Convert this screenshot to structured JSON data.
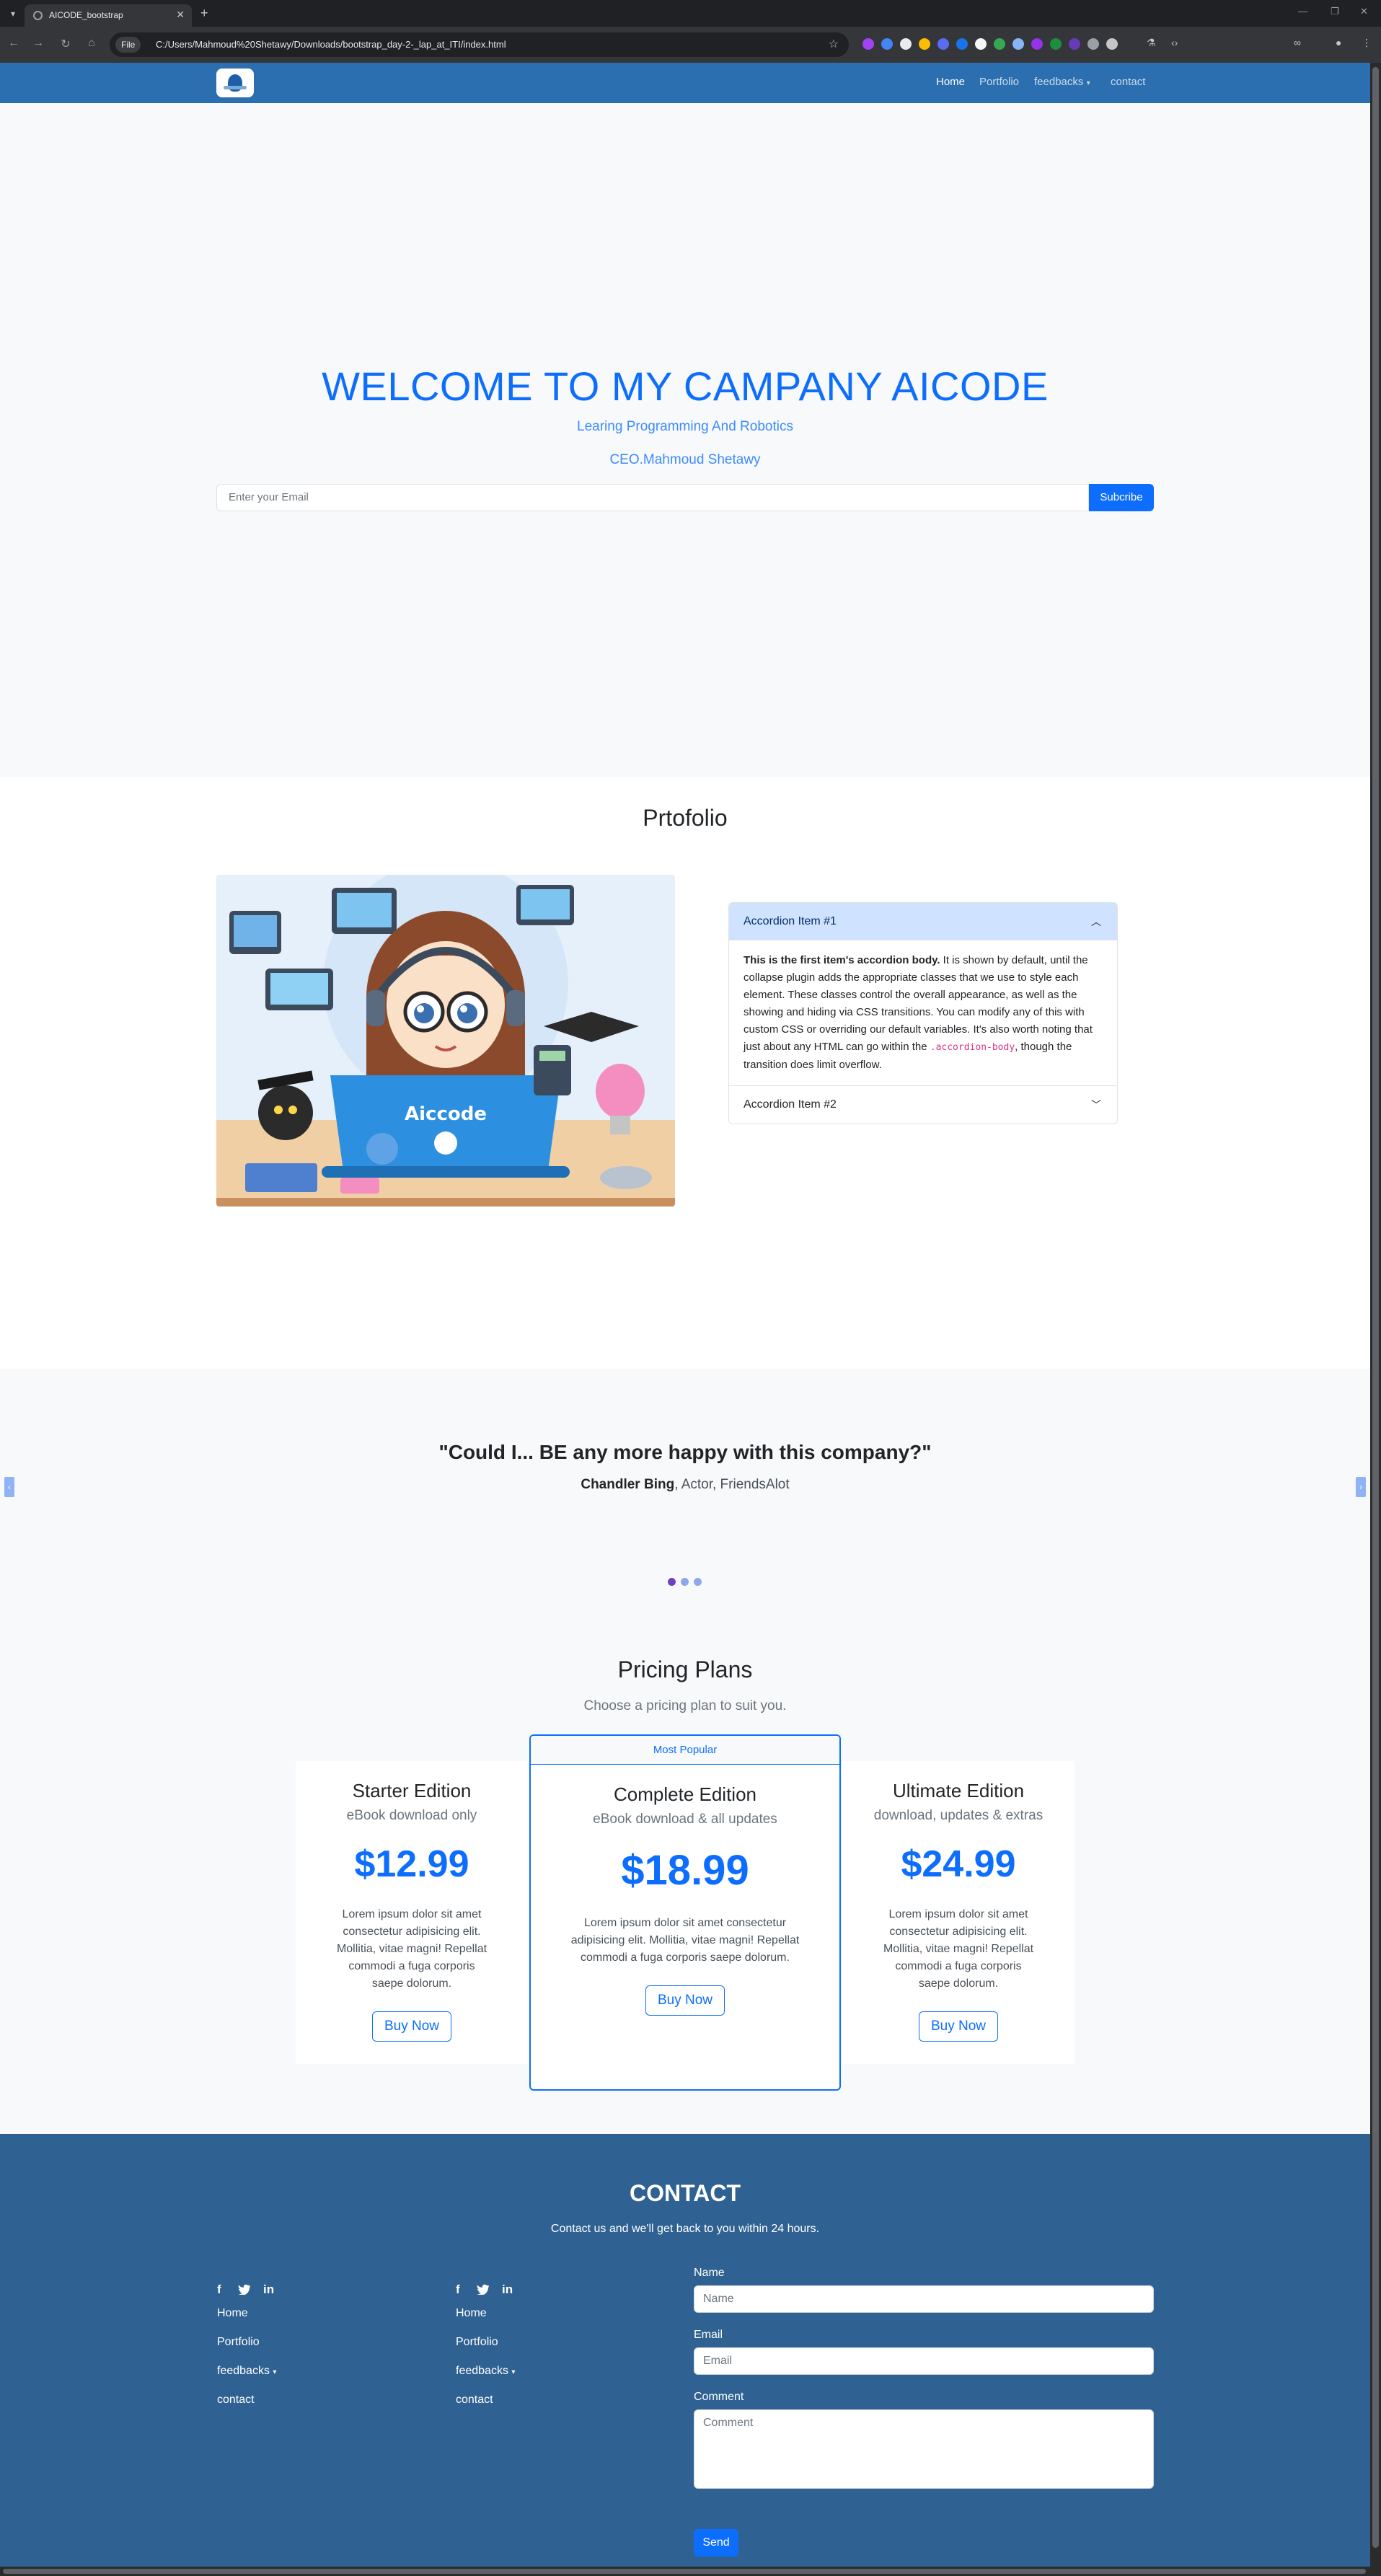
{
  "browser": {
    "tab_title": "AICODE_bootstrap",
    "file_chip": "File",
    "url": "C:/Users/Mahmoud%20Shetawy/Downloads/bootstrap_day-2-_lap_at_ITI/index.html"
  },
  "navbar": {
    "links": [
      "Home",
      "Portfolio",
      "feedbacks",
      "contact"
    ]
  },
  "hero": {
    "title": "WELCOME TO MY CAMPANY AICODE",
    "subtitle": "Learing Programming And Robotics",
    "ceo": "CEO.Mahmoud Shetawy",
    "email_placeholder": "Enter your Email",
    "subscribe_label": "Subcribe"
  },
  "portfolio": {
    "title": "Prtofolio",
    "illustration_text": "Aiccode",
    "accordion": [
      {
        "header": "Accordion Item #1",
        "body_strong": "This is the first item's accordion body.",
        "body_text": " It is shown by default, until the collapse plugin adds the appropriate classes that we use to style each element. These classes control the overall appearance, as well as the showing and hiding via CSS transitions. You can modify any of this with custom CSS or overriding our default variables. It's also worth noting that just about any HTML can go within the ",
        "body_code": ".accordion-body",
        "body_tail": ", though the transition does limit overflow."
      },
      {
        "header": "Accordion Item #2"
      }
    ]
  },
  "testimonial": {
    "quote": "\"Could I... BE any more happy with this company?\"",
    "name": "Chandler Bing",
    "role": ", Actor, FriendsAlot",
    "indicators": 3
  },
  "pricing": {
    "title": "Pricing Plans",
    "subtitle": "Choose a pricing plan to suit you.",
    "plans": [
      {
        "name": "Starter Edition",
        "desc": "eBook download only",
        "price": "$12.99",
        "text": "Lorem ipsum dolor sit amet consectetur adipisicing elit. Mollitia, vitae magni! Repellat commodi a fuga corporis saepe dolorum.",
        "button": "Buy Now"
      },
      {
        "ribbon": "Most Popular",
        "name": "Complete Edition",
        "desc": "eBook download & all updates",
        "price": "$18.99",
        "text": "Lorem ipsum dolor sit amet consectetur adipisicing elit. Mollitia, vitae magni! Repellat commodi a fuga corporis saepe dolorum.",
        "button": "Buy Now"
      },
      {
        "name": "Ultimate Edition",
        "desc": "download, updates & extras",
        "price": "$24.99",
        "text": "Lorem ipsum dolor sit amet consectetur adipisicing elit. Mollitia, vitae magni! Repellat commodi a fuga corporis saepe dolorum.",
        "button": "Buy Now"
      }
    ]
  },
  "contact": {
    "title": "CONTACT",
    "subtitle": "Contact us and we'll get back to you within 24 hours.",
    "social": [
      "f",
      "twitter-icon",
      "in"
    ],
    "links": [
      "Home",
      "Portfolio",
      "feedbacks",
      "contact"
    ],
    "name_label": "Name",
    "name_placeholder": "Name",
    "email_label": "Email",
    "email_placeholder": "Email",
    "comment_label": "Comment",
    "comment_placeholder": "Comment",
    "send_label": "Send"
  },
  "colors": {
    "navbar": "#2c6fb0",
    "primary": "#0d6efd",
    "footer": "#2f6292"
  }
}
